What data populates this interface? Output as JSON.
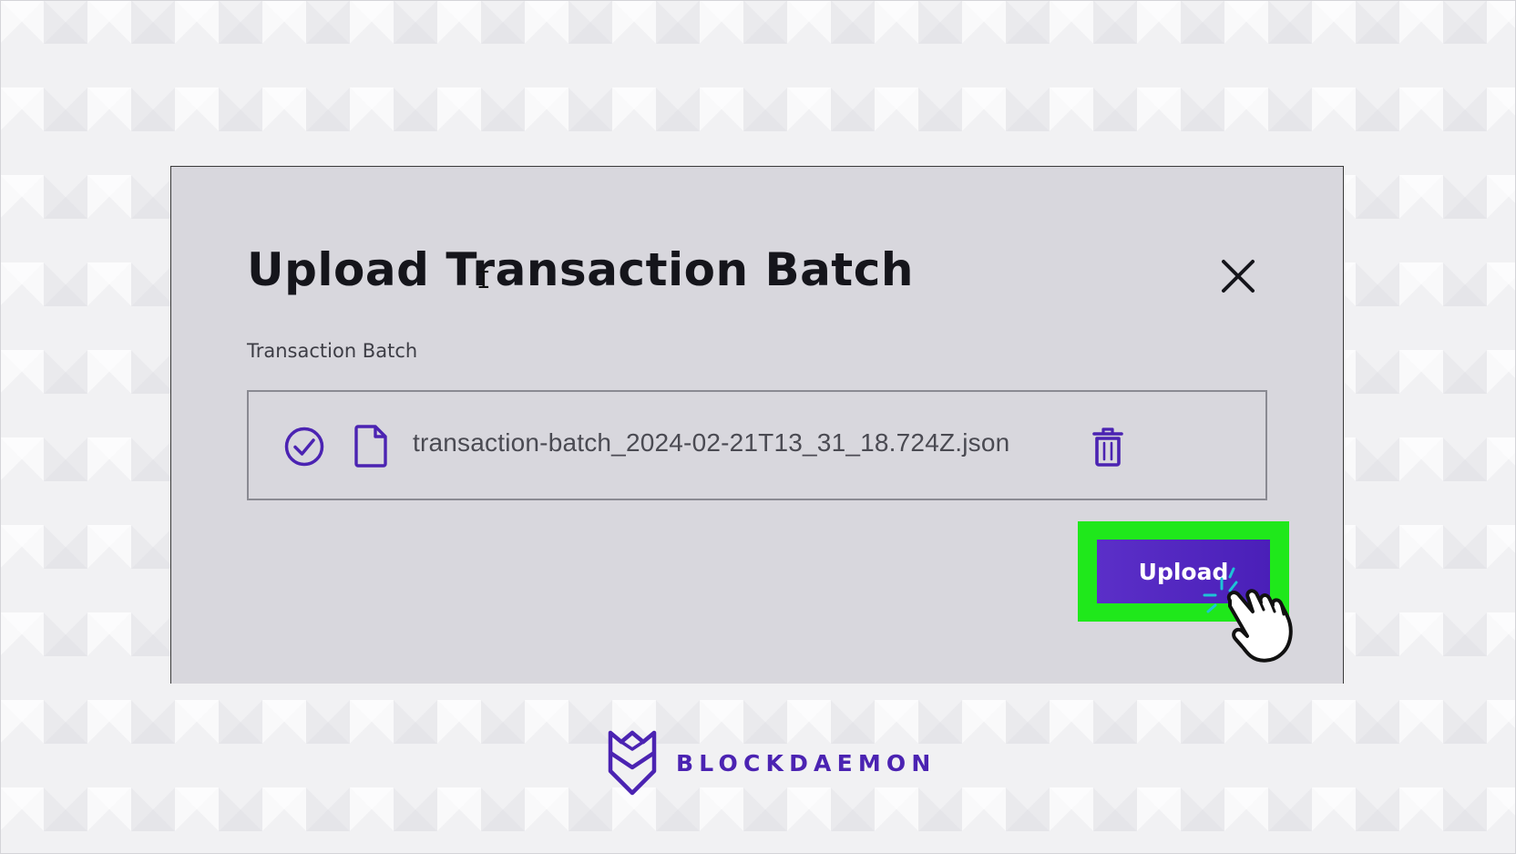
{
  "dialog": {
    "title": "Upload Transaction Batch",
    "field_label": "Transaction Batch",
    "file": {
      "status_icon": "check-circle-icon",
      "type_icon": "file-icon",
      "name": "transaction-batch_2024-02-21T13_31_18.724Z.json",
      "delete_icon": "trash-icon"
    },
    "close_icon": "close-icon",
    "upload_label": "Upload"
  },
  "brand": {
    "name": "BLOCKDAEMON",
    "logo_icon": "blockdaemon-shield-icon"
  },
  "colors": {
    "accent": "#4b23b2",
    "highlight": "#1fe81b",
    "dialog_bg": "#d8d7dd"
  }
}
